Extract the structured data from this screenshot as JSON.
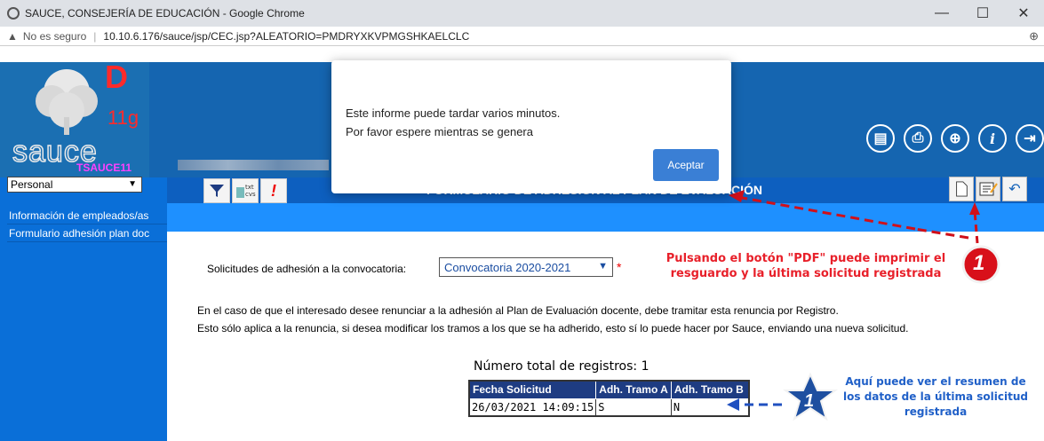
{
  "browser": {
    "window_title": "SAUCE, CONSEJERÍA DE EDUCACIÓN - Google Chrome",
    "security_label": "No es seguro",
    "url": "10.10.6.176/sauce/jsp/CEC.jsp?ALEATORIO=PMDRYXKVPMGSHKAELCLC",
    "minimize": "—",
    "maximize": "☐",
    "close": "✕"
  },
  "logo": {
    "letter": "D",
    "version": "11g",
    "name": "sauce",
    "instance": "TSAUCE11"
  },
  "sidebar": {
    "profile_select": "Personal",
    "items": [
      {
        "label": "Información de empleados/as"
      },
      {
        "label": "Formulario adhesión plan doc"
      }
    ]
  },
  "header": {
    "icons": [
      "book-icon",
      "print-icon",
      "navigation-icon",
      "info-icon",
      "exit-icon"
    ],
    "icon_glyphs": [
      "▤",
      "⎙",
      "⊕",
      "i",
      "⇥"
    ]
  },
  "toolbar": {
    "form_title": "FORMULARIO DE ADHESIÓN AL PLAN DE EVALUACIÓN",
    "form_title_visible": "/ALUACIÓN",
    "alert_glyph": "!"
  },
  "form": {
    "convocatoria_label": "Solicitudes de adhesión a la convocatoria:",
    "convocatoria_value": "Convocatoria 2020-2021",
    "required_mark": "*",
    "para1": "En el caso de que el interesado desee renunciar a la adhesión al Plan de Evaluación docente, debe tramitar esta renuncia por Registro.",
    "para2": "Esto sólo aplica a la renuncia, si desea modificar los tramos a los que se ha adherido, esto sí lo puede hacer por Sauce, enviando una nueva solicitud."
  },
  "table": {
    "total_label": "Número total de registros: 1",
    "columns": [
      "Fecha Solicitud",
      "Adh. Tramo A",
      "Adh. Tramo B"
    ],
    "rows": [
      [
        "26/03/2021 14:09:15",
        "S",
        "N"
      ]
    ]
  },
  "dialog": {
    "line1": "Este informe puede tardar varios minutos.",
    "line2": "Por favor espere mientras se genera",
    "button": "Aceptar"
  },
  "annotations": {
    "red_text": "Pulsando el botón \"PDF\" puede imprimir el resguardo y la última solicitud registrada",
    "red_number": "1",
    "blue_text": "Aquí puede ver el resumen de los datos de la última solicitud registrada",
    "blue_number": "1",
    "red_color": "#e8202a",
    "blue_color": "#2060c8"
  }
}
